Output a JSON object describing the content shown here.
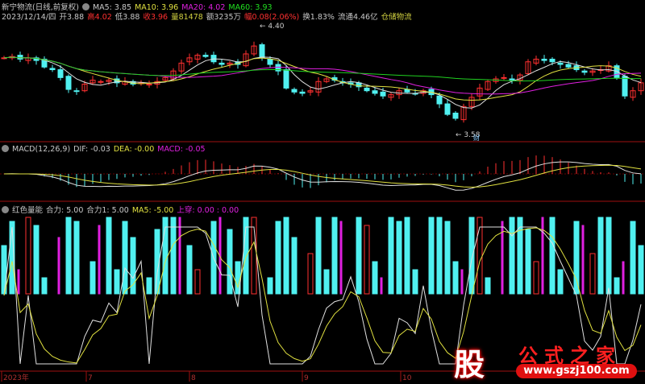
{
  "header": {
    "title": "新宁物流(日线,前复权)",
    "ma5": "MA5: 3.85",
    "ma10": "MA10: 3.96",
    "ma20": "MA20: 4.02",
    "ma60": "MA60: 3.93",
    "date": "2023/12/14/四",
    "open": "开3.88",
    "high": "高4.02",
    "low": "低3.88",
    "close": "收3.96",
    "volume": "量81478",
    "amount": "额3235万",
    "change": "幅0.08(2.06%)",
    "turnover": "换1.83%",
    "float": "流通4.46亿",
    "sector": "仓储物流"
  },
  "annotations": {
    "max": "4.40",
    "min": "3.58",
    "cai": "财"
  },
  "macd": {
    "label": "MACD(12,26,9)",
    "dif": "DIF: -0.03",
    "dea": "DEA: -0.00",
    "macd": "MACD: -0.05"
  },
  "energy": {
    "label": "红色量能",
    "heli": "合力: 5.00",
    "heli1": "合力1: 5.00",
    "ma5": "MA5: -5.00",
    "shangchuan": "上穿: 0.00 : 0.00"
  },
  "xaxis": {
    "labels": [
      "2023年",
      "7",
      "8",
      "9",
      "10"
    ]
  },
  "watermark": {
    "logo": "股",
    "site": "公式之家",
    "url": "www.gszj100.com"
  },
  "colors": {
    "up": "#ff3030",
    "down": "#50f0f0",
    "ma5": "#e0e0e0",
    "ma10": "#e0e040",
    "ma20": "#e020e0",
    "ma60": "#20d020",
    "axis": "#a01010"
  },
  "chart_data": {
    "type": "candlestick",
    "ylim": [
      3.52,
      4.47
    ],
    "max_price": 4.4,
    "min_price": 3.58,
    "closes": [
      4.15,
      4.16,
      4.14,
      4.15,
      4.13,
      4.08,
      4.06,
      4.0,
      3.91,
      3.9,
      3.95,
      3.98,
      3.97,
      3.98,
      3.96,
      3.97,
      3.95,
      3.96,
      3.95,
      3.97,
      4.0,
      4.05,
      4.11,
      4.15,
      4.17,
      4.16,
      4.12,
      4.1,
      4.11,
      4.1,
      4.18,
      4.24,
      4.15,
      4.1,
      4.05,
      3.92,
      3.89,
      3.88,
      3.9,
      3.97,
      3.99,
      3.98,
      3.96,
      3.95,
      3.93,
      3.9,
      3.88,
      3.86,
      3.87,
      3.9,
      3.89,
      3.88,
      3.9,
      3.87,
      3.8,
      3.72,
      3.69,
      3.78,
      3.85,
      3.92,
      3.97,
      3.99,
      4.0,
      3.98,
      4.02,
      4.12,
      4.14,
      4.13,
      4.12,
      4.1,
      4.08,
      4.06,
      4.04,
      4.05,
      4.06,
      4.09,
      4.0,
      3.86,
      3.9,
      3.96
    ],
    "energy_bars": [
      60,
      90,
      30,
      95,
      85,
      20,
      0,
      70,
      95,
      90,
      0,
      40,
      85,
      95,
      30,
      90,
      70,
      0,
      20,
      80,
      95,
      95,
      95,
      60,
      30,
      0,
      90,
      95,
      80,
      40,
      95,
      95,
      0,
      20,
      90,
      95,
      70,
      0,
      50,
      95,
      30,
      95,
      90,
      0,
      95,
      85,
      40,
      20,
      95,
      90,
      95,
      30,
      0,
      95,
      95,
      90,
      40,
      30,
      95,
      95,
      20,
      0,
      90,
      95,
      95,
      80,
      40,
      95,
      95,
      30,
      0,
      90,
      85,
      50,
      95,
      95,
      20,
      40,
      90,
      60
    ]
  }
}
